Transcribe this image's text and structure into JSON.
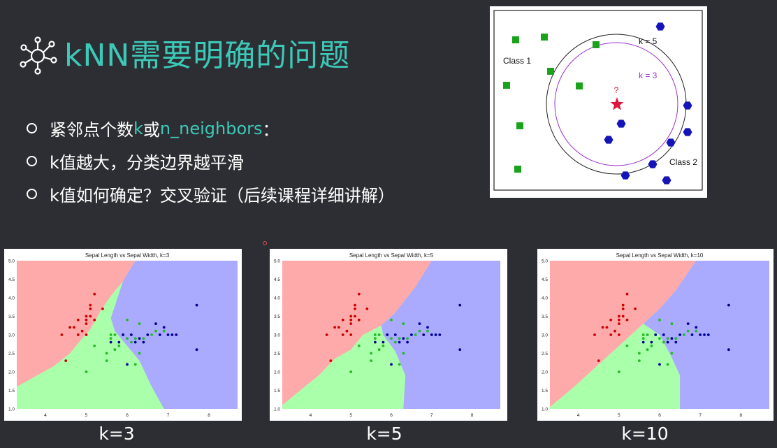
{
  "slide": {
    "title": "kNN需要明确的问题",
    "title_color": "#3cc9b8",
    "background": "#2d2e33",
    "bullets": [
      {
        "parts": [
          {
            "text": "紧邻点个数",
            "hl": false
          },
          {
            "text": "k",
            "hl": true
          },
          {
            "text": "或",
            "hl": false
          },
          {
            "text": "n_neighbors",
            "hl": true
          },
          {
            "text": "：",
            "hl": false
          }
        ]
      },
      {
        "parts": [
          {
            "text": "k值越大，分类边界越平滑",
            "hl": false
          }
        ]
      },
      {
        "parts": [
          {
            "text": "k值如何确定？交叉验证（后续课程详细讲解）",
            "hl": false
          }
        ]
      }
    ]
  },
  "diagram": {
    "class1_label": "Class 1",
    "class2_label": "Class 2",
    "k5_label": "k = 5",
    "k3_label": "k = 3",
    "query_label": "?",
    "class1_color": "#1aa31a",
    "class2_color": "#1414b8",
    "query_color": "#e0143c",
    "k3_color": "#9b30c8"
  },
  "chart_data": [
    {
      "type": "scatter",
      "title": "Sepal Length vs Sepal Width, k=3",
      "caption": "k=3",
      "k": 3,
      "xlim": [
        3.3,
        8.7
      ],
      "ylim": [
        1.0,
        5.0
      ],
      "xticks": [
        4,
        5,
        6,
        7,
        8
      ],
      "yticks": [
        1.0,
        1.5,
        2.0,
        2.5,
        3.0,
        3.5,
        4.0,
        4.5,
        5.0
      ],
      "region_colors": {
        "setosa": "#ffaaaa",
        "versicolor": "#aaffaa",
        "virginica": "#aaaaff"
      },
      "series": [
        {
          "color": "#cc0000",
          "points": [
            [
              4.4,
              3.0
            ],
            [
              4.6,
              3.2
            ],
            [
              4.7,
              3.2
            ],
            [
              4.8,
              3.0
            ],
            [
              4.9,
              3.1
            ],
            [
              5.0,
              3.4
            ],
            [
              5.0,
              3.3
            ],
            [
              5.0,
              3.5
            ],
            [
              5.1,
              3.5
            ],
            [
              5.1,
              3.8
            ],
            [
              5.1,
              3.7
            ],
            [
              5.2,
              3.4
            ],
            [
              5.2,
              4.1
            ],
            [
              5.0,
              3.0
            ],
            [
              4.8,
              3.4
            ],
            [
              5.4,
              3.7
            ],
            [
              4.5,
              2.3
            ]
          ]
        },
        {
          "color": "#22bb22",
          "points": [
            [
              5.0,
              2.0
            ],
            [
              5.2,
              2.7
            ],
            [
              5.5,
              2.5
            ],
            [
              5.6,
              2.9
            ],
            [
              5.6,
              3.0
            ],
            [
              5.7,
              3.0
            ],
            [
              5.8,
              2.7
            ],
            [
              5.9,
              3.0
            ],
            [
              6.0,
              2.9
            ],
            [
              6.0,
              3.4
            ],
            [
              6.1,
              2.8
            ],
            [
              6.2,
              2.2
            ],
            [
              6.3,
              2.5
            ],
            [
              6.3,
              3.3
            ],
            [
              6.4,
              2.9
            ],
            [
              6.7,
              3.1
            ],
            [
              6.6,
              3.0
            ],
            [
              6.9,
              3.1
            ],
            [
              5.7,
              2.6
            ],
            [
              5.5,
              2.3
            ],
            [
              6.2,
              2.9
            ]
          ]
        },
        {
          "color": "#000099",
          "points": [
            [
              5.6,
              2.8
            ],
            [
              5.8,
              2.8
            ],
            [
              6.0,
              2.2
            ],
            [
              6.2,
              2.8
            ],
            [
              6.3,
              2.9
            ],
            [
              6.4,
              2.8
            ],
            [
              6.5,
              3.0
            ],
            [
              6.7,
              3.3
            ],
            [
              6.9,
              3.2
            ],
            [
              7.0,
              3.0
            ],
            [
              7.1,
              3.0
            ],
            [
              7.2,
              3.0
            ],
            [
              7.7,
              3.8
            ],
            [
              7.7,
              2.6
            ],
            [
              6.1,
              3.0
            ],
            [
              5.9,
              3.0
            ],
            [
              6.8,
              3.0
            ]
          ]
        }
      ]
    },
    {
      "type": "scatter",
      "title": "Sepal Length vs Sepal Width, k=5",
      "caption": "k=5",
      "k": 5,
      "xlim": [
        3.3,
        8.7
      ],
      "ylim": [
        1.0,
        5.0
      ],
      "xticks": [
        4,
        5,
        6,
        7,
        8
      ],
      "yticks": [
        1.0,
        1.5,
        2.0,
        2.5,
        3.0,
        3.5,
        4.0,
        4.5,
        5.0
      ],
      "region_colors": {
        "setosa": "#ffaaaa",
        "versicolor": "#aaffaa",
        "virginica": "#aaaaff"
      },
      "series": [
        {
          "color": "#cc0000",
          "points": [
            [
              4.4,
              3.0
            ],
            [
              4.6,
              3.2
            ],
            [
              4.7,
              3.2
            ],
            [
              4.8,
              3.0
            ],
            [
              4.9,
              3.1
            ],
            [
              5.0,
              3.4
            ],
            [
              5.0,
              3.3
            ],
            [
              5.0,
              3.5
            ],
            [
              5.1,
              3.5
            ],
            [
              5.1,
              3.8
            ],
            [
              5.1,
              3.7
            ],
            [
              5.2,
              3.4
            ],
            [
              5.2,
              4.1
            ],
            [
              5.0,
              3.0
            ],
            [
              4.8,
              3.4
            ],
            [
              5.4,
              3.7
            ],
            [
              4.5,
              2.3
            ]
          ]
        },
        {
          "color": "#22bb22",
          "points": [
            [
              5.0,
              2.0
            ],
            [
              5.2,
              2.7
            ],
            [
              5.5,
              2.5
            ],
            [
              5.6,
              2.9
            ],
            [
              5.6,
              3.0
            ],
            [
              5.7,
              3.0
            ],
            [
              5.8,
              2.7
            ],
            [
              5.9,
              3.0
            ],
            [
              6.0,
              2.9
            ],
            [
              6.0,
              3.4
            ],
            [
              6.1,
              2.8
            ],
            [
              6.2,
              2.2
            ],
            [
              6.3,
              2.5
            ],
            [
              6.3,
              3.3
            ],
            [
              6.4,
              2.9
            ],
            [
              6.7,
              3.1
            ],
            [
              6.6,
              3.0
            ],
            [
              6.9,
              3.1
            ],
            [
              5.7,
              2.6
            ],
            [
              5.5,
              2.3
            ],
            [
              6.2,
              2.9
            ]
          ]
        },
        {
          "color": "#000099",
          "points": [
            [
              5.6,
              2.8
            ],
            [
              5.8,
              2.8
            ],
            [
              6.0,
              2.2
            ],
            [
              6.2,
              2.8
            ],
            [
              6.3,
              2.9
            ],
            [
              6.4,
              2.8
            ],
            [
              6.5,
              3.0
            ],
            [
              6.7,
              3.3
            ],
            [
              6.9,
              3.2
            ],
            [
              7.0,
              3.0
            ],
            [
              7.1,
              3.0
            ],
            [
              7.2,
              3.0
            ],
            [
              7.7,
              3.8
            ],
            [
              7.7,
              2.6
            ],
            [
              6.1,
              3.0
            ],
            [
              5.9,
              3.0
            ],
            [
              6.8,
              3.0
            ]
          ]
        }
      ]
    },
    {
      "type": "scatter",
      "title": "Sepal Length vs Sepal Width, k=10",
      "caption": "k=10",
      "k": 10,
      "xlim": [
        3.3,
        8.7
      ],
      "ylim": [
        1.0,
        5.0
      ],
      "xticks": [
        4,
        5,
        6,
        7,
        8
      ],
      "yticks": [
        1.0,
        1.5,
        2.0,
        2.5,
        3.0,
        3.5,
        4.0,
        4.5,
        5.0
      ],
      "region_colors": {
        "setosa": "#ffaaaa",
        "versicolor": "#aaffaa",
        "virginica": "#aaaaff"
      },
      "series": [
        {
          "color": "#cc0000",
          "points": [
            [
              4.4,
              3.0
            ],
            [
              4.6,
              3.2
            ],
            [
              4.7,
              3.2
            ],
            [
              4.8,
              3.0
            ],
            [
              4.9,
              3.1
            ],
            [
              5.0,
              3.4
            ],
            [
              5.0,
              3.3
            ],
            [
              5.0,
              3.5
            ],
            [
              5.1,
              3.5
            ],
            [
              5.1,
              3.8
            ],
            [
              5.1,
              3.7
            ],
            [
              5.2,
              3.4
            ],
            [
              5.2,
              4.1
            ],
            [
              5.0,
              3.0
            ],
            [
              4.8,
              3.4
            ],
            [
              5.4,
              3.7
            ],
            [
              4.5,
              2.3
            ]
          ]
        },
        {
          "color": "#22bb22",
          "points": [
            [
              5.0,
              2.0
            ],
            [
              5.2,
              2.7
            ],
            [
              5.5,
              2.5
            ],
            [
              5.6,
              2.9
            ],
            [
              5.6,
              3.0
            ],
            [
              5.7,
              3.0
            ],
            [
              5.8,
              2.7
            ],
            [
              5.9,
              3.0
            ],
            [
              6.0,
              2.9
            ],
            [
              6.0,
              3.4
            ],
            [
              6.1,
              2.8
            ],
            [
              6.2,
              2.2
            ],
            [
              6.3,
              2.5
            ],
            [
              6.3,
              3.3
            ],
            [
              6.4,
              2.9
            ],
            [
              6.7,
              3.1
            ],
            [
              6.6,
              3.0
            ],
            [
              6.9,
              3.1
            ],
            [
              5.7,
              2.6
            ],
            [
              5.5,
              2.3
            ],
            [
              6.2,
              2.9
            ]
          ]
        },
        {
          "color": "#000099",
          "points": [
            [
              5.6,
              2.8
            ],
            [
              5.8,
              2.8
            ],
            [
              6.0,
              2.2
            ],
            [
              6.2,
              2.8
            ],
            [
              6.3,
              2.9
            ],
            [
              6.4,
              2.8
            ],
            [
              6.5,
              3.0
            ],
            [
              6.7,
              3.3
            ],
            [
              6.9,
              3.2
            ],
            [
              7.0,
              3.0
            ],
            [
              7.1,
              3.0
            ],
            [
              7.2,
              3.0
            ],
            [
              7.7,
              3.8
            ],
            [
              7.7,
              2.6
            ],
            [
              6.1,
              3.0
            ],
            [
              5.9,
              3.0
            ],
            [
              6.8,
              3.0
            ]
          ]
        }
      ]
    }
  ]
}
